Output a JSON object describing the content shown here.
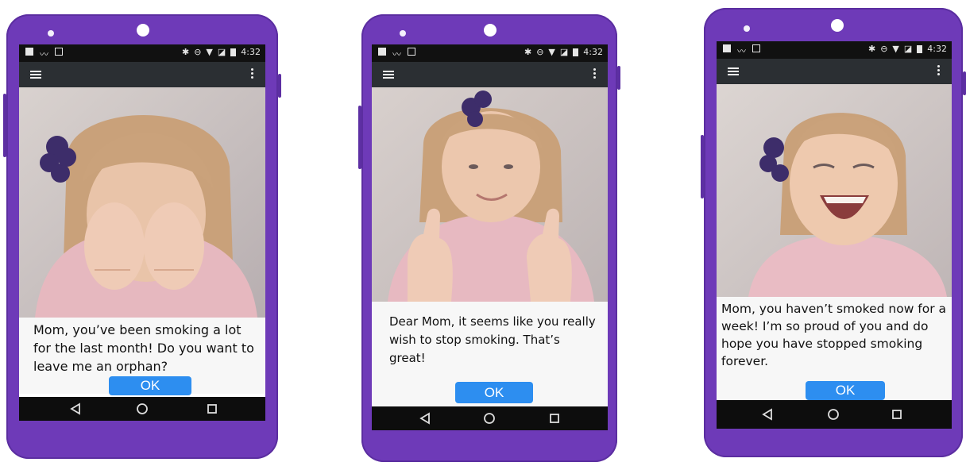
{
  "status": {
    "time": "4:32"
  },
  "screens": [
    {
      "message": "Mom, you’ve been smoking a lot for the last month! Do you want to leave me an orphan?",
      "ok_label": "OK",
      "photo": "girl-covering-face"
    },
    {
      "message": "Dear Mom, it seems like you really wish to stop smoking. That’s great!",
      "ok_label": "OK",
      "photo": "girl-thumbs-up"
    },
    {
      "message": "Mom, you haven’t smoked now for a week! I’m so proud of you and do hope you have stopped smoking forever.",
      "ok_label": "OK",
      "photo": "girl-laughing"
    }
  ],
  "colors": {
    "phone_body": "#6e3ab8",
    "app_bar": "#2b2f33",
    "status_bar": "#111111",
    "ok_button": "#2d8ef0",
    "nav_bar": "#0d0d0d"
  },
  "icons": {
    "menu": "hamburger-icon",
    "overflow": "more-vert-icon",
    "back": "back-triangle-icon",
    "home": "home-circle-icon",
    "recents": "recents-square-icon"
  }
}
